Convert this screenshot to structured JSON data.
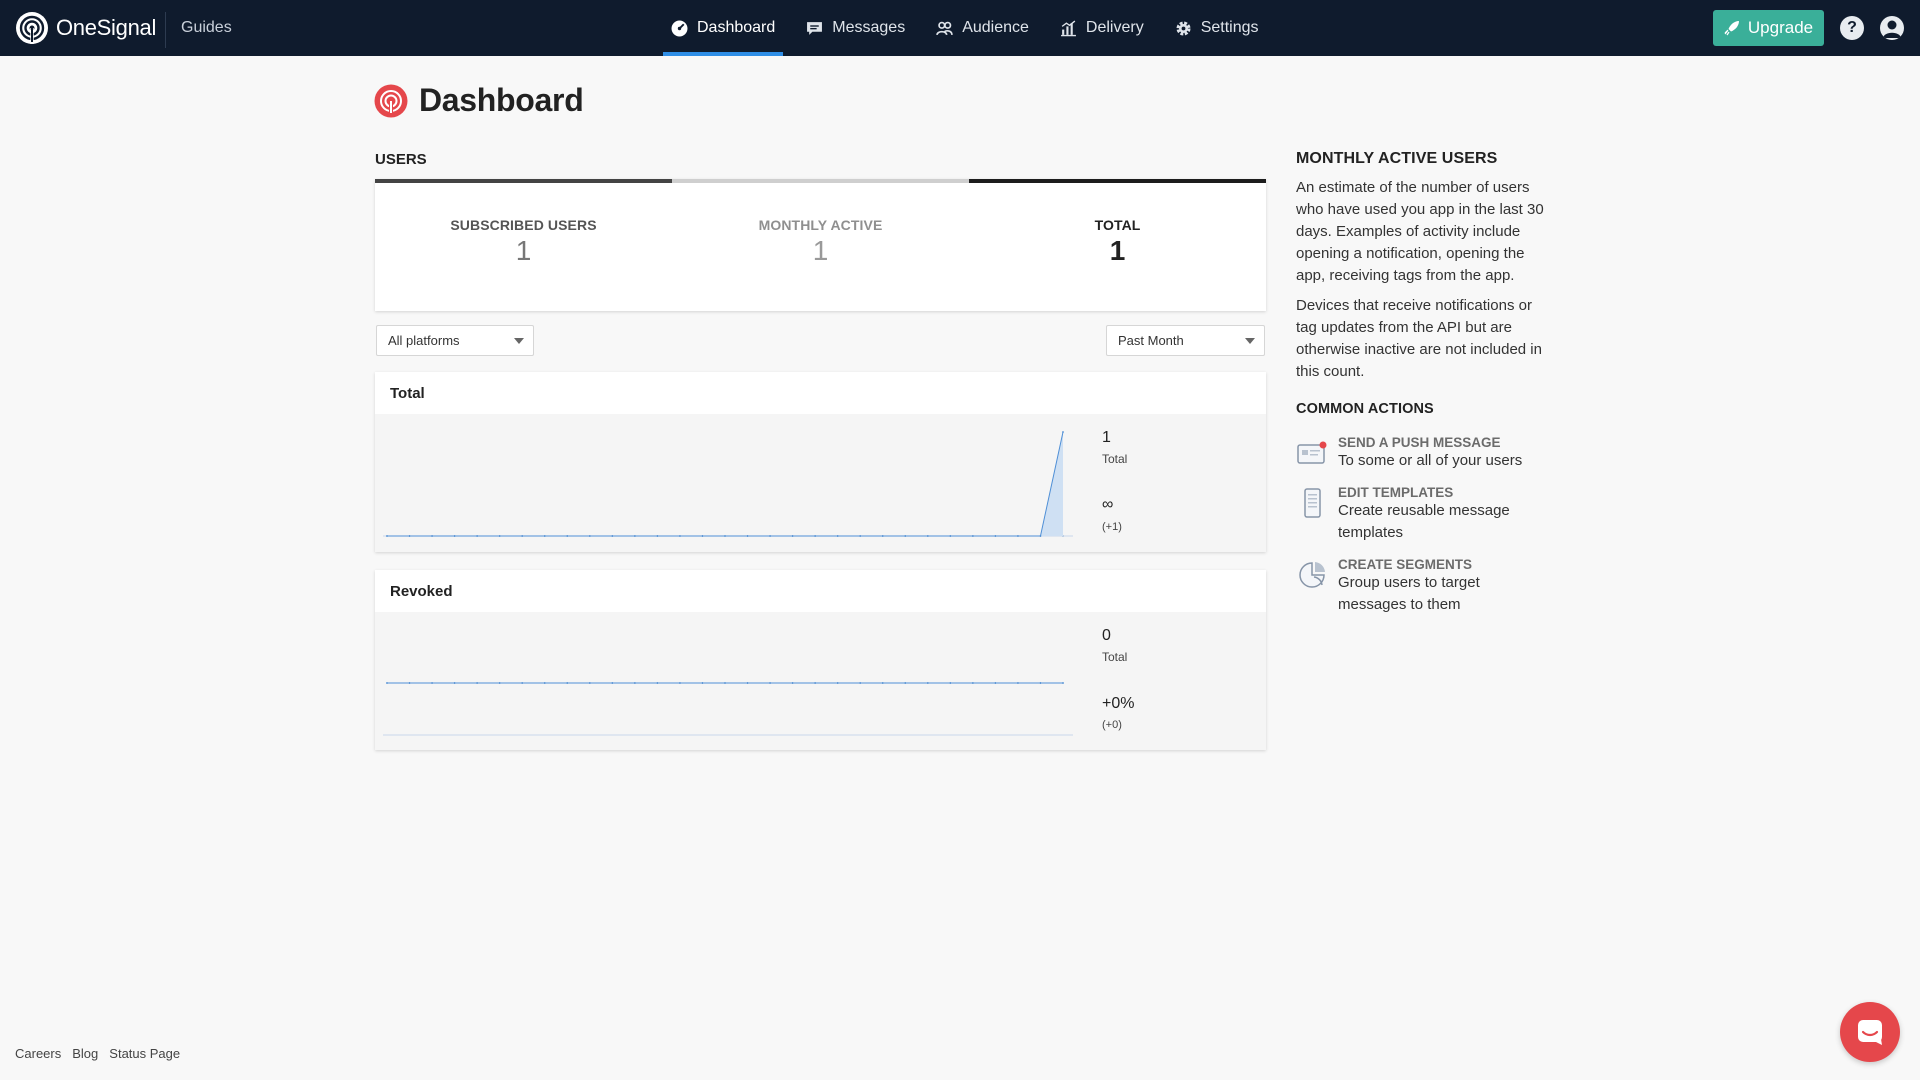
{
  "brand": {
    "name": "OneSignal",
    "guides": "Guides"
  },
  "nav": {
    "tabs": [
      {
        "label": "Dashboard",
        "icon": "dashboard-icon",
        "active": true
      },
      {
        "label": "Messages",
        "icon": "messages-icon"
      },
      {
        "label": "Audience",
        "icon": "audience-icon"
      },
      {
        "label": "Delivery",
        "icon": "delivery-icon"
      },
      {
        "label": "Settings",
        "icon": "settings-icon"
      }
    ],
    "upgrade": "Upgrade",
    "help": "?"
  },
  "page": {
    "title": "Dashboard",
    "section": "USERS"
  },
  "stats": [
    {
      "label": "SUBSCRIBED USERS",
      "value": "1"
    },
    {
      "label": "MONTHLY ACTIVE",
      "value": "1"
    },
    {
      "label": "TOTAL",
      "value": "1"
    }
  ],
  "filters": {
    "platform": "All platforms",
    "range": "Past Month"
  },
  "charts": {
    "total": {
      "title": "Total",
      "value": "1",
      "value_label": "Total",
      "change": "∞",
      "change_sub": "(+1)"
    },
    "revoked": {
      "title": "Revoked",
      "value": "0",
      "value_label": "Total",
      "change": "+0%",
      "change_sub": "(+0)"
    }
  },
  "chart_data": [
    {
      "type": "area",
      "title": "Total",
      "x_count": 31,
      "values": [
        0,
        0,
        0,
        0,
        0,
        0,
        0,
        0,
        0,
        0,
        0,
        0,
        0,
        0,
        0,
        0,
        0,
        0,
        0,
        0,
        0,
        0,
        0,
        0,
        0,
        0,
        0,
        0,
        0,
        0,
        1
      ],
      "color": "#4f8fd6"
    },
    {
      "type": "line",
      "title": "Revoked",
      "x_count": 31,
      "values": [
        0,
        0,
        0,
        0,
        0,
        0,
        0,
        0,
        0,
        0,
        0,
        0,
        0,
        0,
        0,
        0,
        0,
        0,
        0,
        0,
        0,
        0,
        0,
        0,
        0,
        0,
        0,
        0,
        0,
        0,
        0
      ],
      "color": "#4f8fd6"
    }
  ],
  "sidebar": {
    "mau_heading": "MONTHLY ACTIVE USERS",
    "mau_p1": "An estimate of the number of users who have used you app in the last 30 days. Examples of activity include opening a notification, opening the app, receiving tags from the app.",
    "mau_p2": "Devices that receive notifications or tag updates from the API but are otherwise inactive are not included in this count.",
    "actions_heading": "COMMON ACTIONS",
    "actions": [
      {
        "title": "SEND A PUSH MESSAGE",
        "desc": "To some or all of your users",
        "icon": "push-message-icon"
      },
      {
        "title": "EDIT TEMPLATES",
        "desc": "Create reusable message templates",
        "icon": "template-icon"
      },
      {
        "title": "CREATE SEGMENTS",
        "desc": "Group users to target messages to them",
        "icon": "segments-icon"
      }
    ]
  },
  "footer": {
    "links": [
      "Careers",
      "Blog",
      "Status Page"
    ]
  },
  "colors": {
    "nav_bg": "#0f1b2d",
    "accent": "#2f8ee6",
    "upgrade": "#3aaf99",
    "brand_red": "#e5474b"
  }
}
